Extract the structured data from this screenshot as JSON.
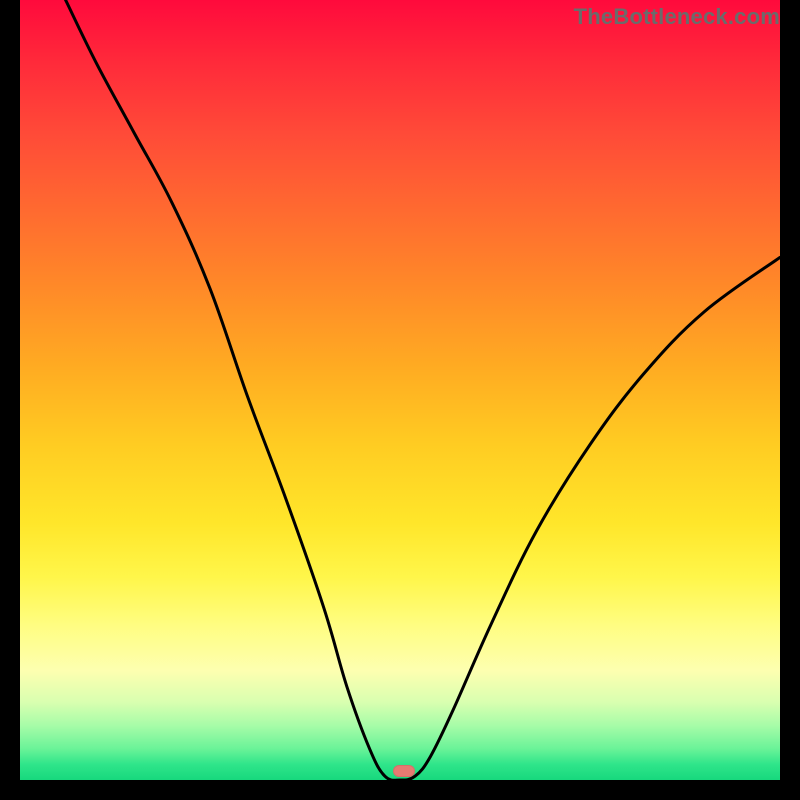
{
  "watermark": "TheBottleneck.com",
  "marker": {
    "x_pct": 50.5,
    "y_pct": 99.0
  },
  "chart_data": {
    "type": "line",
    "title": "",
    "xlabel": "",
    "ylabel": "",
    "xlim": [
      0,
      100
    ],
    "ylim": [
      0,
      100
    ],
    "series": [
      {
        "name": "bottleneck-curve",
        "x": [
          6,
          10,
          15,
          20,
          25,
          30,
          35,
          40,
          43,
          46,
          48,
          50,
          52,
          54,
          57,
          62,
          68,
          75,
          82,
          90,
          100
        ],
        "y": [
          100,
          92,
          83,
          74,
          63,
          49,
          36,
          22,
          12,
          4,
          0.5,
          0,
          0.5,
          3,
          9,
          20,
          32,
          43,
          52,
          60,
          67
        ]
      }
    ],
    "annotations": [
      {
        "type": "marker",
        "x": 50.5,
        "y": 0,
        "color": "#e67a72"
      }
    ],
    "background_gradient": {
      "direction": "top-to-bottom",
      "stops": [
        {
          "pos": 0.0,
          "color": "#ff0a3c"
        },
        {
          "pos": 0.5,
          "color": "#ffcc22"
        },
        {
          "pos": 0.8,
          "color": "#fffd80"
        },
        {
          "pos": 1.0,
          "color": "#17d87d"
        }
      ]
    }
  }
}
